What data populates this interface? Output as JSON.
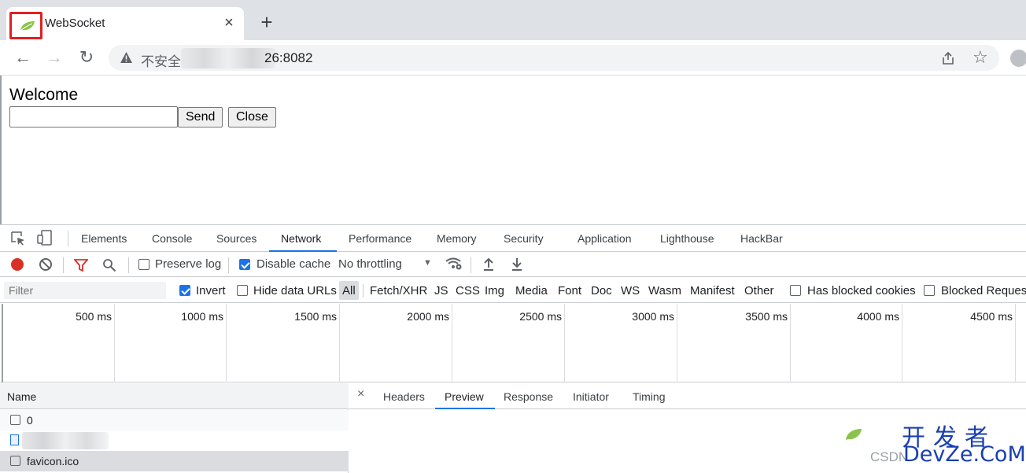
{
  "browser": {
    "tab_title": "WebSocket",
    "tab_close": "×",
    "new_tab": "+",
    "security_label": "不安全",
    "url": "26:8082",
    "nav": {
      "back": "←",
      "forward": "→",
      "reload": "↻"
    },
    "star": "☆"
  },
  "page": {
    "heading": "Welcome",
    "input_value": "",
    "send_label": "Send",
    "close_label": "Close"
  },
  "devtools": {
    "tabs": [
      "Elements",
      "Console",
      "Sources",
      "Network",
      "Performance",
      "Memory",
      "Security",
      "Application",
      "Lighthouse",
      "HackBar"
    ],
    "active_tab": "Network",
    "network_toolbar": {
      "preserve_log": "Preserve log",
      "disable_cache": "Disable cache",
      "throttling": "No throttling",
      "caret": "▼"
    },
    "filter_bar": {
      "filter_placeholder": "Filter",
      "invert": "Invert",
      "hide_data_urls": "Hide data URLs",
      "types": [
        "All",
        "Fetch/XHR",
        "JS",
        "CSS",
        "Img",
        "Media",
        "Font",
        "Doc",
        "WS",
        "Wasm",
        "Manifest",
        "Other"
      ],
      "has_blocked_cookies": "Has blocked cookies",
      "blocked_requests": "Blocked Requests"
    },
    "timeline_labels": [
      "500 ms",
      "1000 ms",
      "1500 ms",
      "2000 ms",
      "2500 ms",
      "3000 ms",
      "3500 ms",
      "4000 ms",
      "4500 ms"
    ],
    "requests": {
      "header": "Name",
      "rows": [
        "0",
        "",
        "favicon.ico"
      ]
    },
    "detail": {
      "close": "×",
      "tabs": [
        "Headers",
        "Preview",
        "Response",
        "Initiator",
        "Timing"
      ],
      "active_tab": "Preview"
    }
  },
  "watermark": {
    "cn": "开发者",
    "csdn": "CSDN",
    "devze": "DevZe.CoM"
  },
  "colors": {
    "accent": "#1a73e8",
    "record": "#d93025",
    "highlight_frame": "#e02020",
    "leaf": "#8bc34a"
  }
}
